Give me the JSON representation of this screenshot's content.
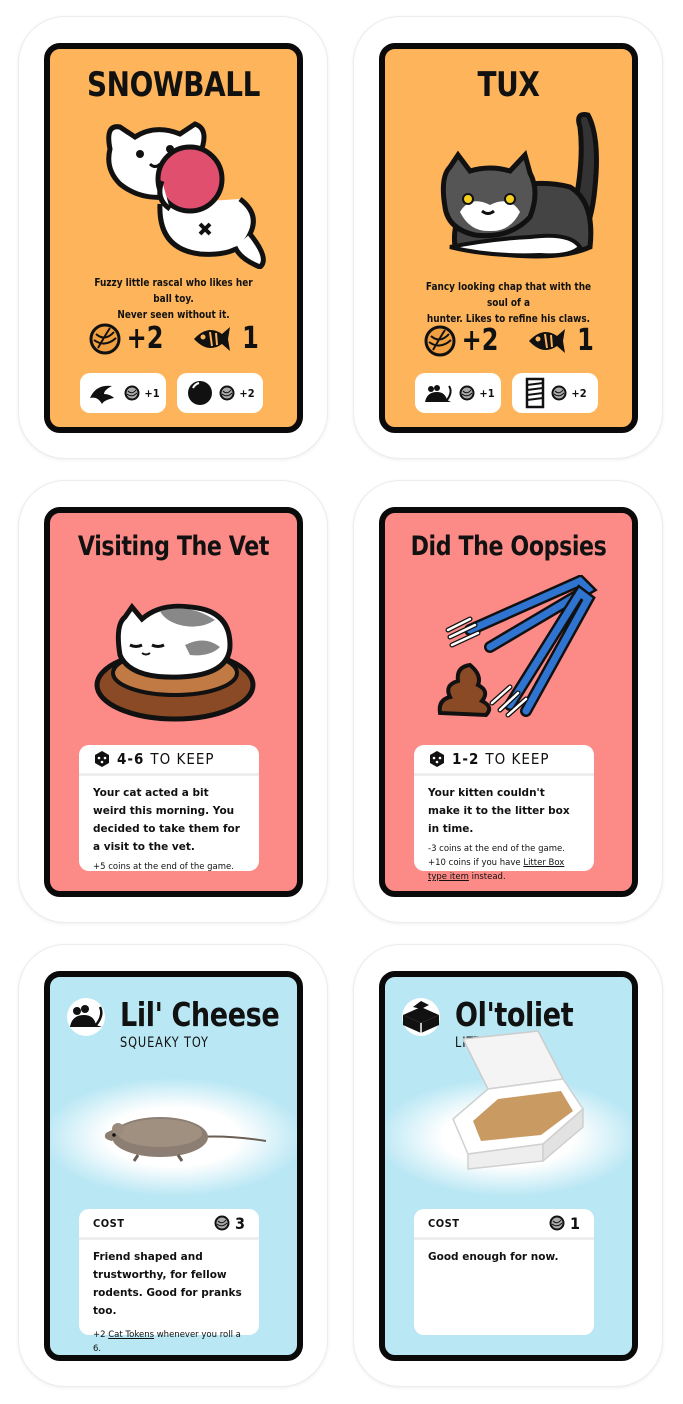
{
  "cards": {
    "snowball": {
      "title": "SNOWBALL",
      "description_line1": "Fuzzy little rascal who likes her ball toy.",
      "description_line2": "Never seen without it.",
      "yarn_stat": "+2",
      "fish_stat": "1",
      "ability1_icon": "feather-toy-icon",
      "ability1_value": "+1",
      "ability2_icon": "ball-icon",
      "ability2_value": "+2"
    },
    "tux": {
      "title": "TUX",
      "description_line1": "Fancy looking chap that with the soul of a",
      "description_line2": "hunter. Likes to refine his claws.",
      "yarn_stat": "+2",
      "fish_stat": "1",
      "ability1_icon": "mouse-toy-icon",
      "ability1_value": "+1",
      "ability2_icon": "scratching-post-icon",
      "ability2_value": "+2"
    },
    "vet": {
      "title": "Visiting The Vet",
      "roll": "4-6",
      "keep": "TO KEEP",
      "body": "Your cat acted a bit weird this morning. You decided to take them for a visit to the vet.",
      "note": "+5 coins at the end of the game."
    },
    "oopsies": {
      "title": "Did The Oopsies",
      "roll": "1-2",
      "keep": "TO KEEP",
      "body": "Your kitten couldn't make it to the litter box in time.",
      "note1": "-3 coins at the end of the game.",
      "note2_prefix": "+10 coins if you have ",
      "note2_link": "Litter Box type item",
      "note2_suffix": " instead."
    },
    "cheese": {
      "title": "Lil' Cheese",
      "subtitle": "SQUEAKY TOY",
      "cost_label": "COST",
      "cost_value": "3",
      "body": "Friend shaped and trustworthy, for fellow rodents. Good for pranks too.",
      "note_prefix": "+2 ",
      "note_link": "Cat Tokens",
      "note_suffix": " whenever you roll a 6."
    },
    "toliet": {
      "title": "Ol'toliet",
      "subtitle": "LITTLER BOX",
      "cost_label": "COST",
      "cost_value": "1",
      "body": "Good enough for now."
    }
  },
  "colors": {
    "cat_card": "#fdb45a",
    "event_card": "#fc8a87",
    "item_card": "#b9e7f4",
    "border": "#0a0a0a"
  }
}
